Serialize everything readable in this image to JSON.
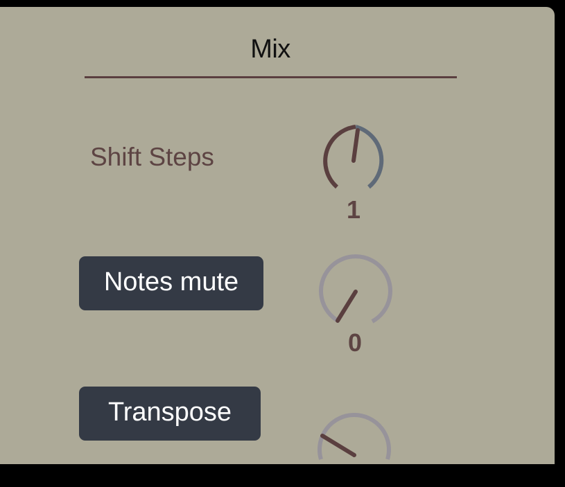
{
  "section": {
    "title": "Mix"
  },
  "shift_steps": {
    "label": "Shift Steps",
    "value": "1"
  },
  "notes_mute": {
    "label": "Notes mute",
    "value": "0"
  },
  "transpose": {
    "label": "Transpose"
  },
  "colors": {
    "background": "#000000",
    "panel": "#adaa98",
    "text": "#5d4443",
    "button": "#343a45",
    "knob_active": "#5a3f3f",
    "knob_track_blue": "#5f6a78",
    "knob_track_gray": "#97939a"
  }
}
